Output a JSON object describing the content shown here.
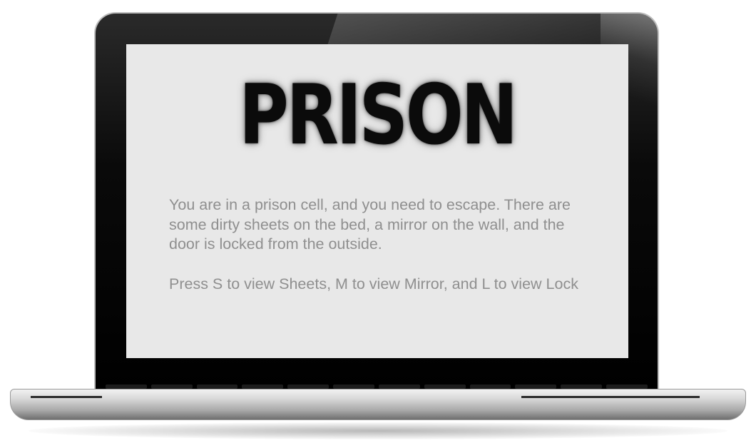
{
  "game": {
    "title": "PRISON",
    "description": "You are in a prison cell, and you need to escape. There are some dirty sheets on the bed, a mirror on the wall, and the door is locked from the outside.",
    "instructions": "Press S to view Sheets, M to view Mirror, and L to view Lock"
  },
  "colors": {
    "screen_background": "#e8e8e8",
    "title_text": "#0b0b0b",
    "body_text": "#8f8f8f",
    "bezel": "#000000",
    "chassis": "#c8c8c8"
  }
}
